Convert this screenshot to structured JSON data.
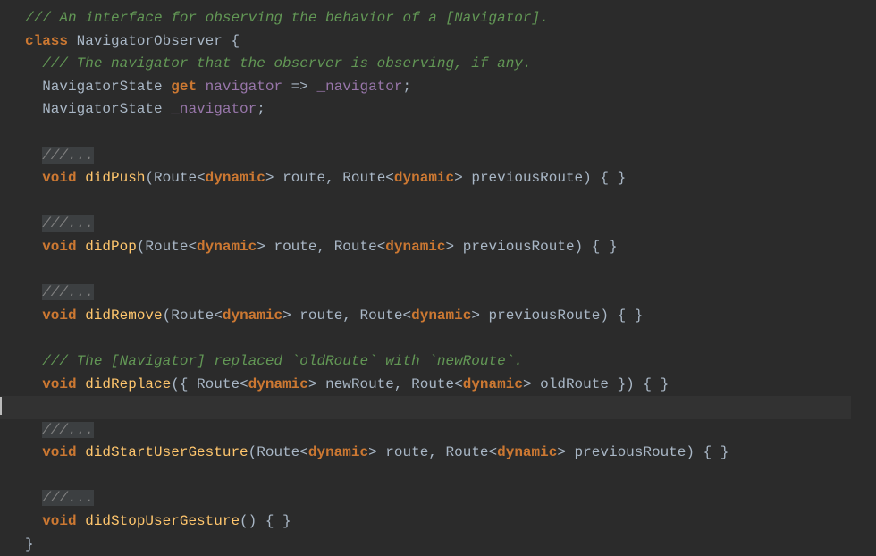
{
  "code": {
    "l1_comment": "/// An interface for observing the behavior of a [Navigator].",
    "l2_class": "class",
    "l2_name": "NavigatorObserver",
    "l2_brace": " {",
    "l3_comment": "/// The navigator that the observer is observing, if any.",
    "l4_type": "NavigatorState",
    "l4_get": "get",
    "l4_prop": "navigator",
    "l4_arrow": " => ",
    "l4_field": "_navigator",
    "l4_semi": ";",
    "l5_type": "NavigatorState",
    "l5_field": "_navigator",
    "l5_semi": ";",
    "ellipsis": "///...",
    "void": "void",
    "didPush": "didPush",
    "didPop": "didPop",
    "didRemove": "didRemove",
    "didReplace": "didReplace",
    "didStartUserGesture": "didStartUserGesture",
    "didStopUserGesture": "didStopUserGesture",
    "route_open": "(Route<",
    "route_open_brace": "({ Route<",
    "dynamic": "dynamic",
    "gt": ">",
    "comma_route": ", Route<",
    "param_route": " route",
    "param_prev": " previousRoute",
    "param_new": " newRoute",
    "param_old": " oldRoute",
    "body_empty": ") { }",
    "body_empty_brace": " }) { }",
    "body_empty_noargs": "() { }",
    "replace_comment": "/// The [Navigator] replaced `oldRoute` with `newRoute`.",
    "close_brace": "}"
  }
}
